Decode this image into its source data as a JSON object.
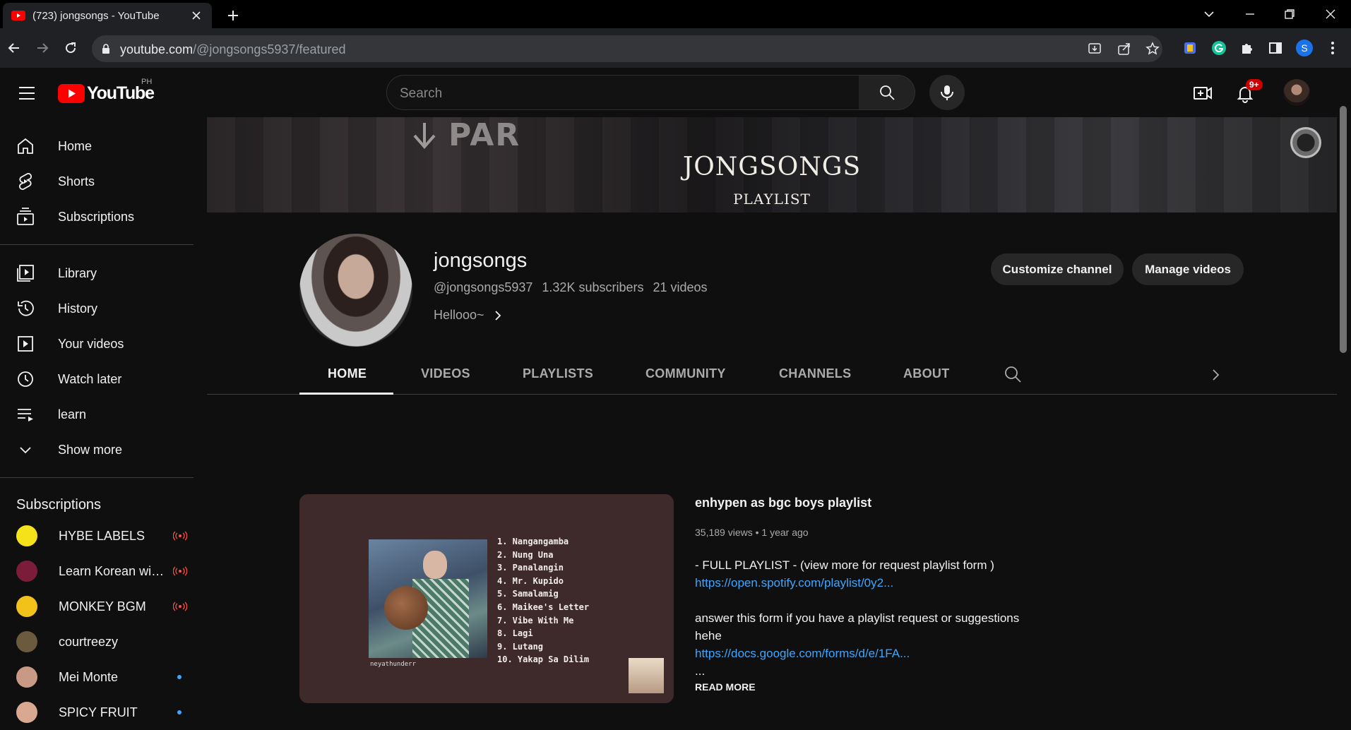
{
  "browser": {
    "tab_title": "(723) jongsongs - YouTube",
    "url_host": "youtube.com",
    "url_path": "/@jongsongs5937/featured",
    "profile_initial": "S"
  },
  "masthead": {
    "logo_text": "YouTube",
    "region": "PH",
    "search_placeholder": "Search",
    "notifications_badge": "9+"
  },
  "sidebar": {
    "primary": [
      {
        "label": "Home",
        "icon": "home-icon"
      },
      {
        "label": "Shorts",
        "icon": "shorts-icon"
      },
      {
        "label": "Subscriptions",
        "icon": "subscriptions-icon"
      }
    ],
    "library": [
      {
        "label": "Library",
        "icon": "library-icon"
      },
      {
        "label": "History",
        "icon": "history-icon"
      },
      {
        "label": "Your videos",
        "icon": "your-videos-icon"
      },
      {
        "label": "Watch later",
        "icon": "watch-later-icon"
      },
      {
        "label": "learn",
        "icon": "playlist-icon"
      },
      {
        "label": "Show more",
        "icon": "chevron-down-icon"
      }
    ],
    "subscriptions_heading": "Subscriptions",
    "subscriptions": [
      {
        "name": "HYBE LABELS",
        "status": "live",
        "color": "#f5e21b"
      },
      {
        "name": "Learn Korean wit...",
        "status": "live",
        "color": "#7b1d3a"
      },
      {
        "name": "MONKEY BGM",
        "status": "live",
        "color": "#f2c21a"
      },
      {
        "name": "courtreezy",
        "status": "none",
        "color": "#6b5a3e"
      },
      {
        "name": "Mei Monte",
        "status": "new",
        "color": "#c89a86"
      },
      {
        "name": "SPICY FRUIT",
        "status": "new",
        "color": "#d8a890"
      }
    ]
  },
  "banner": {
    "line1": "JONGSONGS",
    "line2": "PLAYLIST",
    "sign_text": "PAR"
  },
  "channel": {
    "name": "jongsongs",
    "handle": "@jongsongs5937",
    "subscribers": "1.32K subscribers",
    "videos": "21 videos",
    "description": "Hellooo~",
    "customize_label": "Customize channel",
    "manage_label": "Manage videos"
  },
  "tabs": [
    "HOME",
    "VIDEOS",
    "PLAYLISTS",
    "COMMUNITY",
    "CHANNELS",
    "ABOUT"
  ],
  "featured": {
    "title": "enhypen as bgc boys playlist",
    "views": "35,189 views",
    "age": "1 year ago",
    "desc_line1": "- FULL PLAYLIST - (view more for request playlist form )",
    "link1": "https://open.spotify.com/playlist/0y2...",
    "desc_line2": "answer this form if you have a playlist request or suggestions",
    "desc_line3": "hehe",
    "link2": "https://docs.google.com/forms/d/e/1FA...",
    "ellipsis": "...",
    "read_more": "READ MORE",
    "thumb_credit": "neyathunderr",
    "tracks": [
      "1. Nangangamba",
      "2. Nung Una",
      "3. Panalangin",
      "4. Mr. Kupido",
      "5. Samalamig",
      "6. Maikee's Letter",
      "7. Vibe With Me",
      "8. Lagi",
      "9. Lutang",
      "10. Yakap Sa Dilim"
    ]
  },
  "colors": {
    "brand_red": "#ff0000",
    "link": "#3ea6ff",
    "live_red": "#ff4e45",
    "background": "#0f0f0f"
  }
}
